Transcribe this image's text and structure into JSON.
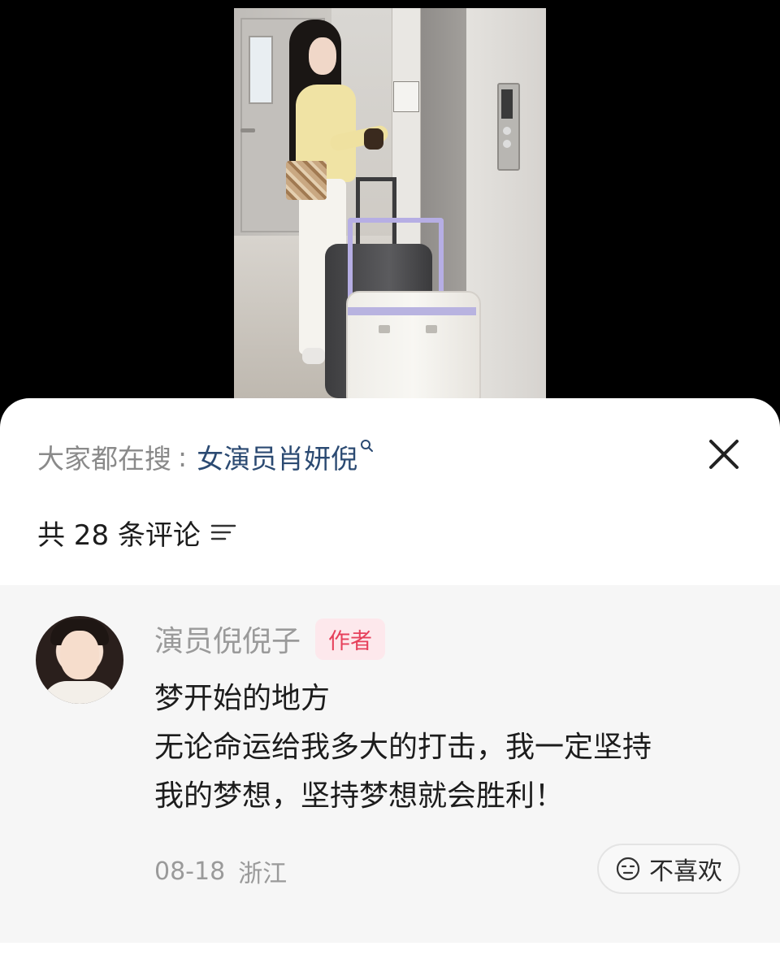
{
  "search": {
    "prefix": "大家都在搜",
    "separator": ":",
    "term": "女演员肖妍倪",
    "icon": "search-icon"
  },
  "close": {
    "icon": "close-icon"
  },
  "comments_header": {
    "count_label": "共 28 条评论",
    "sort_icon": "sort-icon"
  },
  "comment": {
    "author": "演员倪倪子",
    "badge": "作者",
    "lines": [
      "梦开始的地方",
      "无论命运给我多大的打击，我一定坚持",
      "我的梦想，坚持梦想就会胜利！"
    ],
    "date": "08-18",
    "location": "浙江",
    "dislike_label": "不喜欢",
    "dislike_icon": "meh-face-icon"
  },
  "colors": {
    "accent_link": "#2b4a72",
    "badge_text": "#e6405b",
    "badge_bg": "#fde8ec",
    "muted_text": "#9a9a9a",
    "comment_bg": "#f6f6f6"
  }
}
